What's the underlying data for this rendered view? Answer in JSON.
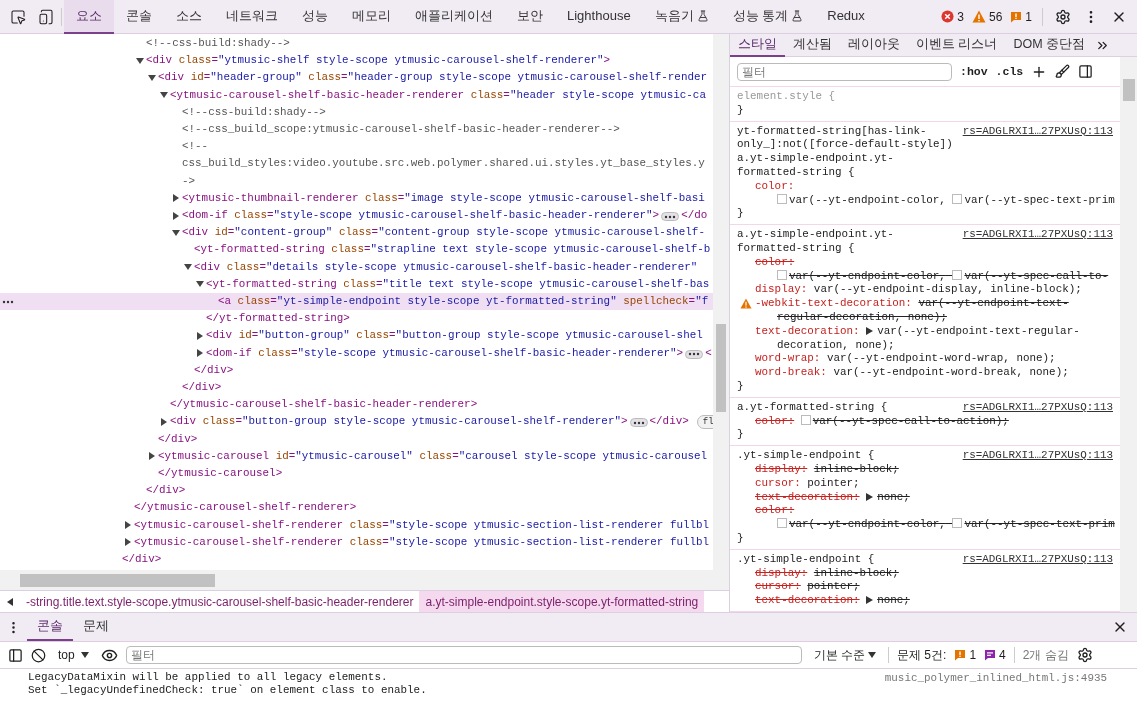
{
  "toolbar": {
    "tabs": [
      {
        "label": "요소",
        "selected": true,
        "experimental": false
      },
      {
        "label": "콘솔",
        "selected": false,
        "experimental": false
      },
      {
        "label": "소스",
        "selected": false,
        "experimental": false
      },
      {
        "label": "네트워크",
        "selected": false,
        "experimental": false
      },
      {
        "label": "성능",
        "selected": false,
        "experimental": false
      },
      {
        "label": "메모리",
        "selected": false,
        "experimental": false
      },
      {
        "label": "애플리케이션",
        "selected": false,
        "experimental": false
      },
      {
        "label": "보안",
        "selected": false,
        "experimental": false
      },
      {
        "label": "Lighthouse",
        "selected": false,
        "experimental": false
      },
      {
        "label": "녹음기",
        "selected": false,
        "experimental": true
      },
      {
        "label": "성능 통계",
        "selected": false,
        "experimental": true
      },
      {
        "label": "Redux",
        "selected": false,
        "experimental": false
      }
    ],
    "counts": [
      {
        "kind": "error",
        "count": "3"
      },
      {
        "kind": "warning",
        "count": "56"
      },
      {
        "kind": "issue",
        "count": "1"
      }
    ]
  },
  "elements": {
    "tree": [
      {
        "kind": "element",
        "close": "</div>",
        "children": [
          {
            "kind": "element",
            "close": "</ytmusic-carousel-shelf-renderer>",
            "children": [
              {
                "kind": "comment",
                "text": "<!--css-build:shady-->",
                "selected": false
              },
              {
                "kind": "element",
                "text": "<div class=\"ytmusic-shelf style-scope ytmusic-carousel-shelf-renderer\">",
                "expanded": true,
                "selected": false,
                "close": "</div>",
                "children": [
                  {
                    "kind": "element",
                    "text": "<div id=\"header-group\" class=\"header-group style-scope ytmusic-carousel-shelf-render",
                    "expanded": true,
                    "selected": false,
                    "close": "</div>",
                    "children": [
                      {
                        "kind": "element",
                        "text": "<ytmusic-carousel-shelf-basic-header-renderer class=\"header style-scope ytmusic-ca",
                        "expanded": true,
                        "selected": false,
                        "close": "</ytmusic-carousel-shelf-basic-header-renderer>",
                        "children": [
                          {
                            "kind": "comment",
                            "text": "<!--css-build:shady-->",
                            "selected": false
                          },
                          {
                            "kind": "comment",
                            "text": "<!--css_build_scope:ytmusic-carousel-shelf-basic-header-renderer-->",
                            "selected": false
                          },
                          {
                            "kind": "comment",
                            "text": "<!--\ncss_build_styles:video.youtube.src.web.polymer.shared.ui.styles.yt_base_styles.y\n->",
                            "selected": false
                          },
                          {
                            "kind": "element",
                            "text": "<ytmusic-thumbnail-renderer class=\"image style-scope ytmusic-carousel-shelf-basi",
                            "expanded": false,
                            "selected": false
                          },
                          {
                            "kind": "element",
                            "text": "<dom-if class=\"style-scope ytmusic-carousel-shelf-basic-header-renderer\">",
                            "expanded": false,
                            "selected": false,
                            "ellipsis": true,
                            "tail": "</do"
                          },
                          {
                            "kind": "element",
                            "text": "<div id=\"content-group\" class=\"content-group style-scope ytmusic-carousel-shelf-",
                            "expanded": true,
                            "selected": false,
                            "close": "</div>",
                            "children": [
                              {
                                "kind": "element",
                                "text": "<yt-formatted-string class=\"strapline text style-scope ytmusic-carousel-shelf-b",
                                "selected": false
                              },
                              {
                                "kind": "element",
                                "text": "<div class=\"details style-scope ytmusic-carousel-shelf-basic-header-renderer\"",
                                "expanded": true,
                                "selected": false,
                                "close": "</div>",
                                "children": [
                                  {
                                    "kind": "element",
                                    "text": "<yt-formatted-string class=\"title text style-scope ytmusic-carousel-shelf-bas",
                                    "expanded": true,
                                    "selected": false,
                                    "close": "</yt-formatted-string>",
                                    "children": [
                                      {
                                        "kind": "element",
                                        "text": "<a class=\"yt-simple-endpoint style-scope yt-formatted-string\" spellcheck=\"f",
                                        "selected": true
                                      }
                                    ]
                                  },
                                  {
                                    "kind": "element",
                                    "text": "<div id=\"button-group\" class=\"button-group style-scope ytmusic-carousel-shel",
                                    "expanded": false,
                                    "selected": false
                                  },
                                  {
                                    "kind": "element",
                                    "text": "<dom-if class=\"style-scope ytmusic-carousel-shelf-basic-header-renderer\">",
                                    "expanded": false,
                                    "selected": false,
                                    "ellipsis": true,
                                    "tail": "<"
                                  }
                                ]
                              }
                            ]
                          }
                        ]
                      },
                      {
                        "kind": "element",
                        "text": "<div class=\"button-group style-scope ytmusic-carousel-shelf-renderer\">",
                        "expanded": false,
                        "selected": false,
                        "ellipsis": true,
                        "tail": "</div>",
                        "badge": "fl"
                      }
                    ]
                  },
                  {
                    "kind": "element",
                    "text": "<ytmusic-carousel id=\"ytmusic-carousel\" class=\"carousel style-scope ytmusic-carousel",
                    "expanded": false,
                    "selected": false,
                    "close": "</ytmusic-carousel>"
                  }
                ]
              }
            ]
          },
          {
            "kind": "element",
            "text": "<ytmusic-carousel-shelf-renderer class=\"style-scope ytmusic-section-list-renderer fullbl",
            "expanded": false,
            "selected": false
          },
          {
            "kind": "element",
            "text": "<ytmusic-carousel-shelf-renderer class=\"style-scope ytmusic-section-list-renderer fullbl",
            "expanded": false,
            "selected": false
          }
        ]
      }
    ],
    "breadcrumbs": [
      {
        "text": "-string.title.text.style-scope.ytmusic-carousel-shelf-basic-header-renderer",
        "selected": false
      },
      {
        "text": "a.yt-simple-endpoint.style-scope.yt-formatted-string",
        "selected": true
      }
    ]
  },
  "styles": {
    "tabs": [
      {
        "label": "스타일",
        "selected": true
      },
      {
        "label": "계산됨",
        "selected": false
      },
      {
        "label": "레이아웃",
        "selected": false
      },
      {
        "label": "이벤트 리스너",
        "selected": false
      },
      {
        "label": "DOM 중단점",
        "selected": false
      }
    ],
    "filter": {
      "placeholder": "필터"
    },
    "hov": ":hov",
    "cls": ".cls",
    "rules": [
      {
        "kind": "inline",
        "selector": "element.style {",
        "close": "}"
      },
      {
        "kind": "matched",
        "selector": "yt-formatted-string[has-link-only_]:not([force-default-style]) a.yt-simple-endpoint.yt-formatted-string {",
        "source": "rs=ADGLRXI1…27PXUsQ:113",
        "close": "}",
        "properties": [
          {
            "name": "color:",
            "value": [
              {
                "text": "var(--yt-endpoint-color,"
              },
              {
                "text": "var(--yt-spec-text-prim"
              }
            ],
            "name_struck": false,
            "value_struck": false,
            "warning": false,
            "expander": false
          }
        ]
      },
      {
        "kind": "matched",
        "selector": "a.yt-simple-endpoint.yt-formatted-string {",
        "source": "rs=ADGLRXI1…27PXUsQ:113",
        "close": "}",
        "properties": [
          {
            "name": "color:",
            "value": [
              {
                "text": "var(--yt-endpoint-color,"
              },
              {
                "text": "var(--yt-spec-call-to-"
              }
            ],
            "name_struck": true,
            "value_struck": true,
            "warning": false,
            "expander": false
          },
          {
            "name": "display:",
            "value": "var(--yt-endpoint-display, inline-block);",
            "name_struck": false,
            "value_struck": false,
            "warning": false,
            "expander": false
          },
          {
            "name": "-webkit-text-decoration:",
            "value": "var(--yt-endpoint-text-regular-decoration, none);",
            "name_struck": false,
            "value_struck": true,
            "warning": true,
            "expander": false
          },
          {
            "name": "text-decoration:",
            "value": "var(--yt-endpoint-text-regular-decoration, none);",
            "name_struck": false,
            "value_struck": false,
            "warning": false,
            "expander": true
          },
          {
            "name": "word-wrap:",
            "value": "var(--yt-endpoint-word-wrap, none);",
            "name_struck": false,
            "value_struck": false,
            "warning": false,
            "expander": false
          },
          {
            "name": "word-break:",
            "value": "var(--yt-endpoint-word-break, none);",
            "name_struck": false,
            "value_struck": false,
            "warning": false,
            "expander": false
          }
        ]
      },
      {
        "kind": "matched",
        "selector": "a.yt-formatted-string {",
        "source": "rs=ADGLRXI1…27PXUsQ:113",
        "close": "}",
        "properties": [
          {
            "name": "color:",
            "value": [
              {
                "text": "var(--yt-spec-call-to-action);"
              }
            ],
            "name_struck": true,
            "value_struck": true,
            "warning": false,
            "expander": false
          }
        ]
      },
      {
        "kind": "matched",
        "selector": ".yt-simple-endpoint {",
        "source": "rs=ADGLRXI1…27PXUsQ:113",
        "close": "}",
        "properties": [
          {
            "name": "display:",
            "value": "inline-block;",
            "name_struck": true,
            "value_struck": true,
            "warning": false,
            "expander": false
          },
          {
            "name": "cursor:",
            "value": "pointer;",
            "name_struck": false,
            "value_struck": false,
            "warning": false,
            "expander": false
          },
          {
            "name": "text-decoration:",
            "value": "none;",
            "name_struck": true,
            "value_struck": true,
            "warning": false,
            "expander": true
          },
          {
            "name": "color:",
            "value": [
              {
                "text": "var(--yt-endpoint-color,"
              },
              {
                "text": "var(--yt-spec-text-prim"
              }
            ],
            "name_struck": true,
            "value_struck": true,
            "warning": false,
            "expander": false
          }
        ]
      },
      {
        "kind": "matched",
        "selector": ".yt-simple-endpoint {",
        "source": "rs=ADGLRXI1…27PXUsQ:113",
        "properties": [
          {
            "name": "display:",
            "value": "inline-block;",
            "name_struck": true,
            "value_struck": true,
            "warning": false,
            "expander": false
          },
          {
            "name": "cursor:",
            "value": "pointer;",
            "name_struck": true,
            "value_struck": true,
            "warning": false,
            "expander": false
          },
          {
            "name": "text-decoration:",
            "value": "none;",
            "name_struck": true,
            "value_struck": true,
            "warning": false,
            "expander": true
          }
        ]
      }
    ]
  },
  "drawer": {
    "tabs": [
      {
        "label": "콘솔",
        "selected": true
      },
      {
        "label": "문제",
        "selected": false
      }
    ],
    "context": "top",
    "filter": {
      "placeholder": "필터"
    },
    "level": "기본 수준",
    "issues_label": "문제 5건:",
    "counts": [
      {
        "kind": "issue",
        "count": "1"
      },
      {
        "kind": "info",
        "count": "4"
      }
    ],
    "hidden": "2개 숨김",
    "messages": [
      {
        "text": "LegacyDataMixin will be applied to all legacy elements.\nSet `_legacyUndefinedCheck: true` on element class to enable.",
        "source": "music_polymer_inlined_html.js:4935"
      }
    ]
  }
}
